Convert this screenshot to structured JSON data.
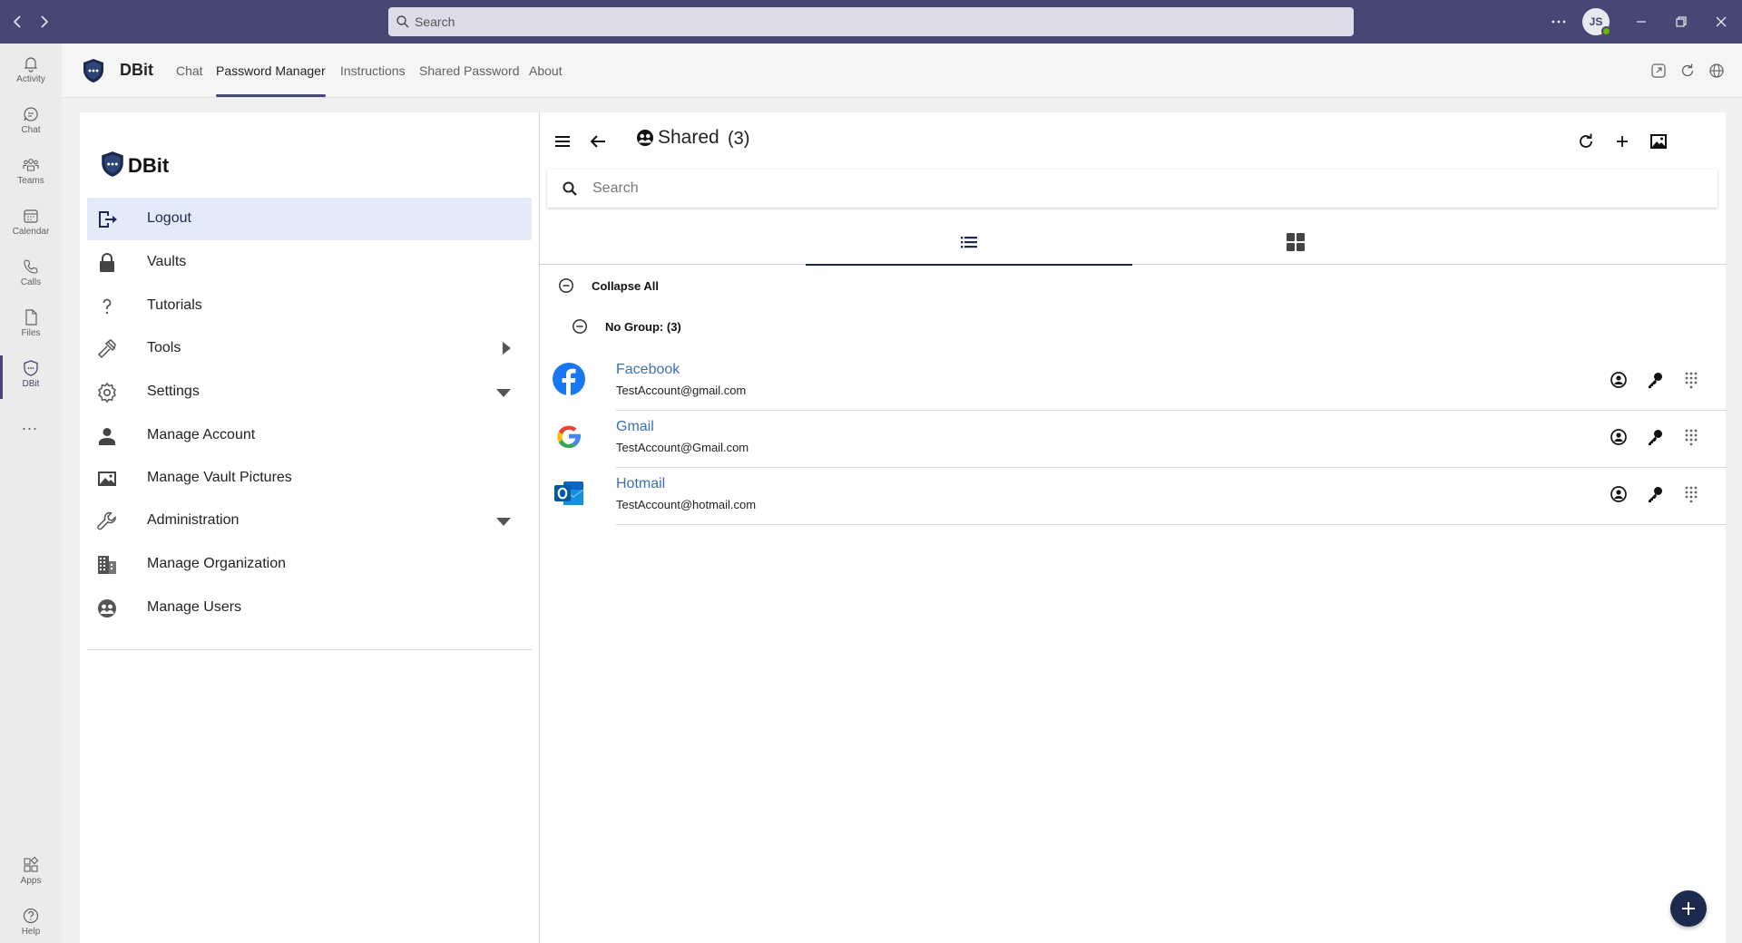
{
  "titlebar": {
    "search_placeholder": "Search",
    "avatar_initials": "JS"
  },
  "rail": {
    "items": [
      {
        "label": "Activity",
        "icon": "bell-icon"
      },
      {
        "label": "Chat",
        "icon": "chat-icon"
      },
      {
        "label": "Teams",
        "icon": "teams-icon"
      },
      {
        "label": "Calendar",
        "icon": "calendar-icon"
      },
      {
        "label": "Calls",
        "icon": "phone-icon"
      },
      {
        "label": "Files",
        "icon": "file-icon"
      },
      {
        "label": "DBit",
        "icon": "shield-icon"
      }
    ],
    "more": "...",
    "bottom": [
      {
        "label": "Apps",
        "icon": "apps-icon"
      },
      {
        "label": "Help",
        "icon": "help-icon"
      }
    ]
  },
  "app": {
    "title": "DBit",
    "tabs": [
      "Chat",
      "Password Manager",
      "Instructions",
      "Shared Password",
      "About"
    ],
    "active_tab": "Password Manager"
  },
  "sidebar": {
    "title": "DBit",
    "items": [
      {
        "label": "Logout",
        "icon": "logout-icon",
        "active": true
      },
      {
        "label": "Vaults",
        "icon": "lock-icon"
      },
      {
        "label": "Tutorials",
        "icon": "question-icon"
      },
      {
        "label": "Tools",
        "icon": "hammer-icon",
        "caret": "right"
      },
      {
        "label": "Settings",
        "icon": "gear-icon",
        "caret": "down"
      },
      {
        "label": "Manage Account",
        "icon": "person-icon"
      },
      {
        "label": "Manage Vault Pictures",
        "icon": "image-icon"
      },
      {
        "label": "Administration",
        "icon": "wrench-icon",
        "caret": "down"
      },
      {
        "label": "Manage Organization",
        "icon": "building-icon"
      },
      {
        "label": "Manage Users",
        "icon": "users-icon"
      }
    ]
  },
  "main": {
    "title": "Shared",
    "count": "(3)",
    "search_placeholder": "Search",
    "collapse_all": "Collapse All",
    "group_label": "No Group: (3)",
    "entries": [
      {
        "name": "Facebook",
        "username": "TestAccount@gmail.com",
        "icon": "facebook-icon"
      },
      {
        "name": "Gmail",
        "username": "TestAccount@Gmail.com",
        "icon": "google-icon"
      },
      {
        "name": "Hotmail",
        "username": "TestAccount@hotmail.com",
        "icon": "outlook-icon"
      }
    ]
  },
  "colors": {
    "titlebar": "#464775",
    "navy": "#1b2a4e",
    "link": "#3c6fb5",
    "active_item": "#e3eaf8"
  }
}
